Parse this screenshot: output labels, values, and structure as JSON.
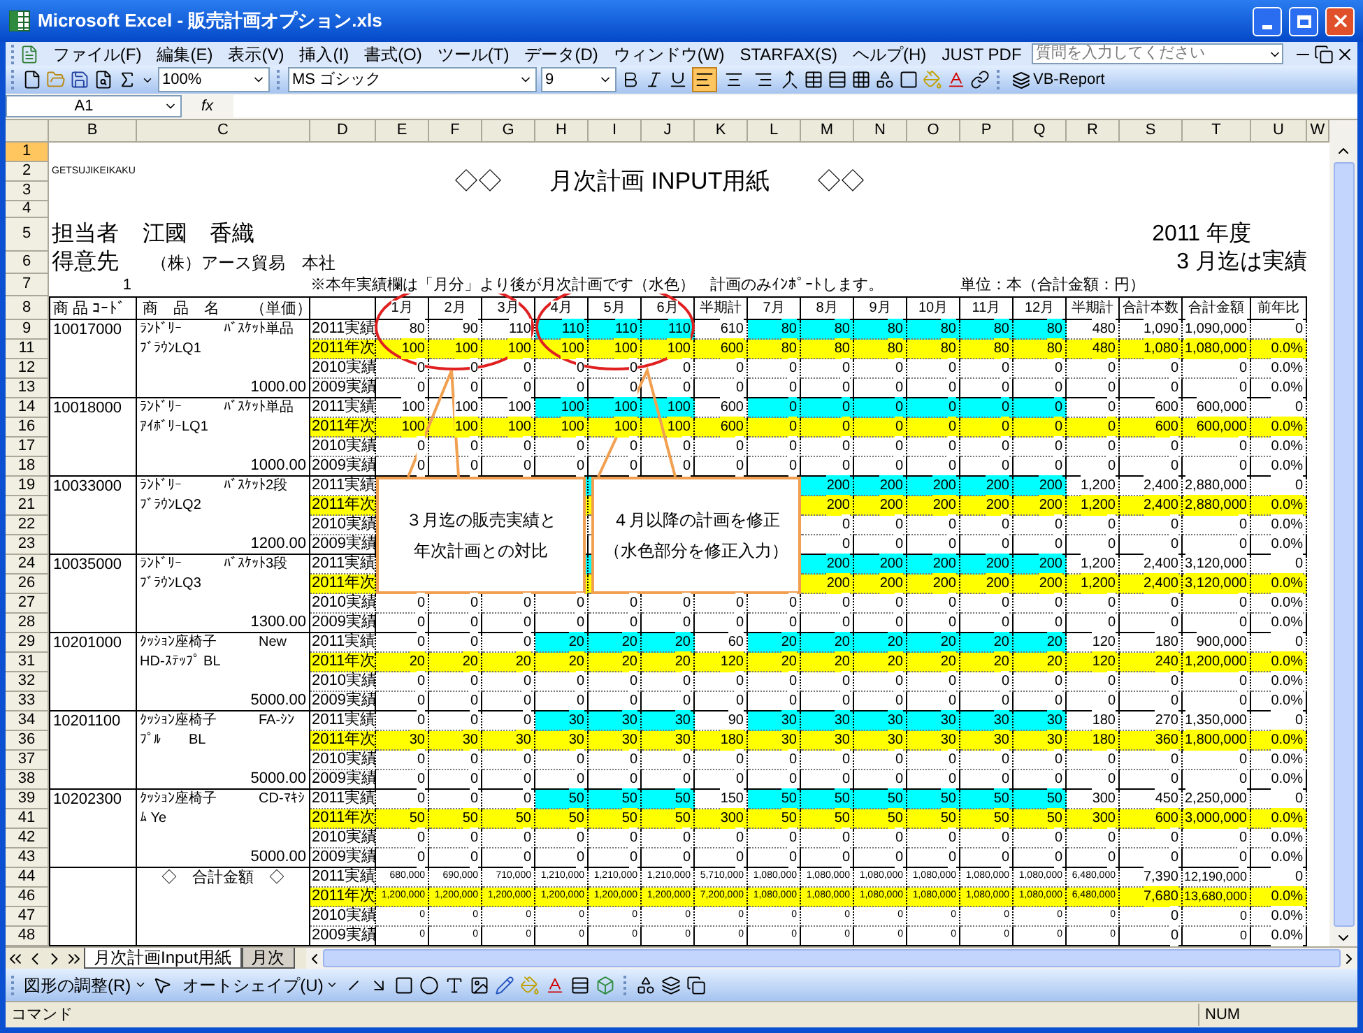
{
  "window": {
    "title": "Microsoft Excel - 販売計画オプション.xls"
  },
  "menu": [
    "ファイル(F)",
    "編集(E)",
    "表示(V)",
    "挿入(I)",
    "書式(O)",
    "ツール(T)",
    "データ(D)",
    "ウィンドウ(W)",
    "STARFAX(S)",
    "ヘルプ(H)",
    "JUST PDF"
  ],
  "help_search": {
    "placeholder": "質問を入力してください"
  },
  "toolbar": {
    "zoom": "100%",
    "font": "MS ゴシック",
    "size": "9",
    "addin": "VB-Report",
    "align_buttons": [
      {
        "selected": true
      },
      {
        "selected": false
      },
      {
        "selected": false
      }
    ]
  },
  "formula_bar": {
    "name_box": "A1",
    "function_label": "fx"
  },
  "columns": [
    "B",
    "C",
    "D",
    "E",
    "F",
    "G",
    "H",
    "I",
    "J",
    "K",
    "L",
    "M",
    "N",
    "O",
    "P",
    "Q",
    "R",
    "S",
    "T",
    "U",
    "W"
  ],
  "top_rows": [
    "1",
    "2",
    "3",
    "4",
    "5",
    "6",
    "7",
    "8"
  ],
  "sheet": {
    "code_label": "GETSUJIKEIKAKU",
    "title": "◇◇　　月次計画 INPUT用紙　　◇◇",
    "staff_label": "担当者",
    "staff_name": "江國　香織",
    "customer_label": "得意先",
    "customer_name": "（株）アース貿易　本社",
    "year": "2011 年度",
    "actual_until": "3 月迄は実績",
    "page_no": "1",
    "note": "※本年実績欄は「月分」より後が月次計画です（水色）　計画のみｲﾝﾎﾟｰﾄします。",
    "unit": "単位：本（合計金額：円）"
  },
  "table": {
    "code_header": "商 品 ｺｰﾄﾞ",
    "name_header": "商　品　名　　（単価）",
    "headers": [
      {
        "label": "1月",
        "editable": false
      },
      {
        "label": "2月",
        "editable": false
      },
      {
        "label": "3月",
        "editable": false
      },
      {
        "label": "4月",
        "editable": true
      },
      {
        "label": "5月",
        "editable": true
      },
      {
        "label": "6月",
        "editable": true
      },
      {
        "label": "半期計",
        "editable": false
      },
      {
        "label": "7月",
        "editable": true
      },
      {
        "label": "8月",
        "editable": true
      },
      {
        "label": "9月",
        "editable": true
      },
      {
        "label": "10月",
        "editable": true
      },
      {
        "label": "11月",
        "editable": true
      },
      {
        "label": "12月",
        "editable": true
      },
      {
        "label": "半期計",
        "editable": false
      },
      {
        "label": "合計本数",
        "editable": false
      },
      {
        "label": "合計金額",
        "editable": false
      },
      {
        "label": "前年比",
        "editable": false
      }
    ],
    "groups": [
      {
        "kind": "product",
        "code": "10017000",
        "name": [
          "ﾗﾝﾄﾞﾘｰ　　　ﾊﾞｽｹｯﾄ単品",
          "ﾌﾞﾗｳﾝLQ1"
        ],
        "price": "1000.00",
        "rows": [
          {
            "n": "9",
            "type": "2011実績",
            "kind": "actual",
            "cells": [
              "80",
              "90",
              "110",
              "110",
              "110",
              "110",
              "610",
              "80",
              "80",
              "80",
              "80",
              "80",
              "80",
              "480",
              "1,090",
              "1,090,000",
              "0"
            ]
          },
          {
            "n": "11",
            "type": "2011年次",
            "kind": "plan",
            "cells": [
              "100",
              "100",
              "100",
              "100",
              "100",
              "100",
              "600",
              "80",
              "80",
              "80",
              "80",
              "80",
              "80",
              "480",
              "1,080",
              "1,080,000",
              "0.0%"
            ]
          },
          {
            "n": "12",
            "type": "2010実績",
            "kind": "past",
            "cells": [
              "0",
              "0",
              "0",
              "0",
              "0",
              "0",
              "0",
              "0",
              "0",
              "0",
              "0",
              "0",
              "0",
              "0",
              "0",
              "0",
              "0.0%"
            ]
          },
          {
            "n": "13",
            "type": "2009実績",
            "kind": "past",
            "cells": [
              "0",
              "0",
              "0",
              "0",
              "0",
              "0",
              "0",
              "0",
              "0",
              "0",
              "0",
              "0",
              "0",
              "0",
              "0",
              "0",
              "0.0%"
            ]
          }
        ]
      },
      {
        "kind": "product",
        "code": "10018000",
        "name": [
          "ﾗﾝﾄﾞﾘｰ　　　ﾊﾞｽｹｯﾄ単品",
          "ｱｲﾎﾞﾘｰLQ1"
        ],
        "price": "1000.00",
        "rows": [
          {
            "n": "14",
            "type": "2011実績",
            "kind": "actual",
            "cells": [
              "100",
              "100",
              "100",
              "100",
              "100",
              "100",
              "600",
              "0",
              "0",
              "0",
              "0",
              "0",
              "0",
              "0",
              "600",
              "600,000",
              "0"
            ]
          },
          {
            "n": "16",
            "type": "2011年次",
            "kind": "plan",
            "cells": [
              "100",
              "100",
              "100",
              "100",
              "100",
              "100",
              "600",
              "0",
              "0",
              "0",
              "0",
              "0",
              "0",
              "0",
              "600",
              "600,000",
              "0.0%"
            ]
          },
          {
            "n": "17",
            "type": "2010実績",
            "kind": "past",
            "cells": [
              "0",
              "0",
              "0",
              "0",
              "0",
              "0",
              "0",
              "0",
              "0",
              "0",
              "0",
              "0",
              "0",
              "0",
              "0",
              "0",
              "0.0%"
            ]
          },
          {
            "n": "18",
            "type": "2009実績",
            "kind": "past",
            "cells": [
              "0",
              "0",
              "0",
              "0",
              "0",
              "0",
              "0",
              "0",
              "0",
              "0",
              "0",
              "0",
              "0",
              "0",
              "0",
              "0",
              "0.0%"
            ]
          }
        ]
      },
      {
        "kind": "product",
        "code": "10033000",
        "name": [
          "ﾗﾝﾄﾞﾘｰ　　　ﾊﾞｽｹｯﾄ2段",
          "ﾌﾞﾗｳﾝLQ2"
        ],
        "price": "1200.00",
        "rows": [
          {
            "n": "19",
            "type": "2011実績",
            "kind": "actual",
            "cells": [
              null,
              null,
              null,
              null,
              null,
              null,
              null,
              null,
              "200",
              "200",
              "200",
              "200",
              "200",
              "1,200",
              "2,400",
              "2,880,000",
              "0"
            ]
          },
          {
            "n": "21",
            "type": "2011年次",
            "kind": "plan",
            "cells": [
              null,
              null,
              null,
              null,
              null,
              null,
              null,
              null,
              "200",
              "200",
              "200",
              "200",
              "200",
              "1,200",
              "2,400",
              "2,880,000",
              "0.0%"
            ]
          },
          {
            "n": "22",
            "type": "2010実績",
            "kind": "past",
            "cells": [
              null,
              null,
              null,
              null,
              null,
              null,
              null,
              null,
              "0",
              "0",
              "0",
              "0",
              "0",
              "0",
              "0",
              "0",
              "0.0%"
            ]
          },
          {
            "n": "23",
            "type": "2009実績",
            "kind": "past",
            "cells": [
              null,
              null,
              null,
              null,
              null,
              null,
              null,
              null,
              "0",
              "0",
              "0",
              "0",
              "0",
              "0",
              "0",
              "0",
              "0.0%"
            ]
          }
        ]
      },
      {
        "kind": "product",
        "code": "10035000",
        "name": [
          "ﾗﾝﾄﾞﾘｰ　　　ﾊﾞｽｹｯﾄ3段",
          "ﾌﾞﾗｳﾝLQ3"
        ],
        "price": "1300.00",
        "rows": [
          {
            "n": "24",
            "type": "2011実績",
            "kind": "actual",
            "cells": [
              null,
              null,
              null,
              null,
              null,
              null,
              null,
              null,
              "200",
              "200",
              "200",
              "200",
              "200",
              "1,200",
              "2,400",
              "3,120,000",
              "0"
            ]
          },
          {
            "n": "26",
            "type": "2011年次",
            "kind": "plan",
            "cells": [
              null,
              null,
              null,
              null,
              null,
              null,
              null,
              null,
              "200",
              "200",
              "200",
              "200",
              "200",
              "1,200",
              "2,400",
              "3,120,000",
              "0.0%"
            ]
          },
          {
            "n": "27",
            "type": "2010実績",
            "kind": "past",
            "cells": [
              "0",
              "0",
              "0",
              "0",
              "0",
              "0",
              "0",
              "0",
              "0",
              "0",
              "0",
              "0",
              "0",
              "0",
              "0",
              "0",
              "0.0%"
            ]
          },
          {
            "n": "28",
            "type": "2009実績",
            "kind": "past",
            "cells": [
              "0",
              "0",
              "0",
              "0",
              "0",
              "0",
              "0",
              "0",
              "0",
              "0",
              "0",
              "0",
              "0",
              "0",
              "0",
              "0",
              "0.0%"
            ]
          }
        ]
      },
      {
        "kind": "product",
        "code": "10201000",
        "name": [
          "ｸｯｼｮﾝ座椅子　　　New",
          "HD-ｽﾃｯﾌﾟ BL"
        ],
        "price": "5000.00",
        "rows": [
          {
            "n": "29",
            "type": "2011実績",
            "kind": "actual",
            "cells": [
              "0",
              "0",
              "0",
              "20",
              "20",
              "20",
              "60",
              "20",
              "20",
              "20",
              "20",
              "20",
              "20",
              "120",
              "180",
              "900,000",
              "0"
            ]
          },
          {
            "n": "31",
            "type": "2011年次",
            "kind": "plan",
            "cells": [
              "20",
              "20",
              "20",
              "20",
              "20",
              "20",
              "120",
              "20",
              "20",
              "20",
              "20",
              "20",
              "20",
              "120",
              "240",
              "1,200,000",
              "0.0%"
            ]
          },
          {
            "n": "32",
            "type": "2010実績",
            "kind": "past",
            "cells": [
              "0",
              "0",
              "0",
              "0",
              "0",
              "0",
              "0",
              "0",
              "0",
              "0",
              "0",
              "0",
              "0",
              "0",
              "0",
              "0",
              "0.0%"
            ]
          },
          {
            "n": "33",
            "type": "2009実績",
            "kind": "past",
            "cells": [
              "0",
              "0",
              "0",
              "0",
              "0",
              "0",
              "0",
              "0",
              "0",
              "0",
              "0",
              "0",
              "0",
              "0",
              "0",
              "0",
              "0.0%"
            ]
          }
        ]
      },
      {
        "kind": "product",
        "code": "10201100",
        "name": [
          "ｸｯｼｮﾝ座椅子　　　FA-ｼﾝ",
          "ﾌﾟﾙ　　BL"
        ],
        "price": "5000.00",
        "rows": [
          {
            "n": "34",
            "type": "2011実績",
            "kind": "actual",
            "cells": [
              "0",
              "0",
              "0",
              "30",
              "30",
              "30",
              "90",
              "30",
              "30",
              "30",
              "30",
              "30",
              "30",
              "180",
              "270",
              "1,350,000",
              "0"
            ]
          },
          {
            "n": "36",
            "type": "2011年次",
            "kind": "plan",
            "cells": [
              "30",
              "30",
              "30",
              "30",
              "30",
              "30",
              "180",
              "30",
              "30",
              "30",
              "30",
              "30",
              "30",
              "180",
              "360",
              "1,800,000",
              "0.0%"
            ]
          },
          {
            "n": "37",
            "type": "2010実績",
            "kind": "past",
            "cells": [
              "0",
              "0",
              "0",
              "0",
              "0",
              "0",
              "0",
              "0",
              "0",
              "0",
              "0",
              "0",
              "0",
              "0",
              "0",
              "0",
              "0.0%"
            ]
          },
          {
            "n": "38",
            "type": "2009実績",
            "kind": "past",
            "cells": [
              "0",
              "0",
              "0",
              "0",
              "0",
              "0",
              "0",
              "0",
              "0",
              "0",
              "0",
              "0",
              "0",
              "0",
              "0",
              "0",
              "0.0%"
            ]
          }
        ]
      },
      {
        "kind": "product",
        "code": "10202300",
        "name": [
          "ｸｯｼｮﾝ座椅子　　　CD-ﾏｷｼ",
          "ﾑ Ye"
        ],
        "price": "5000.00",
        "rows": [
          {
            "n": "39",
            "type": "2011実績",
            "kind": "actual",
            "cells": [
              "0",
              "0",
              "0",
              "50",
              "50",
              "50",
              "150",
              "50",
              "50",
              "50",
              "50",
              "50",
              "50",
              "300",
              "450",
              "2,250,000",
              "0"
            ]
          },
          {
            "n": "41",
            "type": "2011年次",
            "kind": "plan",
            "cells": [
              "50",
              "50",
              "50",
              "50",
              "50",
              "50",
              "300",
              "50",
              "50",
              "50",
              "50",
              "50",
              "50",
              "300",
              "600",
              "3,000,000",
              "0.0%"
            ]
          },
          {
            "n": "42",
            "type": "2010実績",
            "kind": "past",
            "cells": [
              "0",
              "0",
              "0",
              "0",
              "0",
              "0",
              "0",
              "0",
              "0",
              "0",
              "0",
              "0",
              "0",
              "0",
              "0",
              "0",
              "0.0%"
            ]
          },
          {
            "n": "43",
            "type": "2009実績",
            "kind": "past",
            "cells": [
              "0",
              "0",
              "0",
              "0",
              "0",
              "0",
              "0",
              "0",
              "0",
              "0",
              "0",
              "0",
              "0",
              "0",
              "0",
              "0",
              "0.0%"
            ]
          }
        ]
      },
      {
        "kind": "total",
        "name": [
          "◇　合計金額　◇"
        ],
        "rows": [
          {
            "n": "44",
            "type": "2011実績",
            "kind": "sum",
            "cells": [
              "680,000",
              "690,000",
              "710,000",
              "1,210,000",
              "1,210,000",
              "1,210,000",
              "5,710,000",
              "1,080,000",
              "1,080,000",
              "1,080,000",
              "1,080,000",
              "1,080,000",
              "1,080,000",
              "6,480,000",
              "7,390",
              "12,190,000",
              "0"
            ]
          },
          {
            "n": "46",
            "type": "2011年次",
            "kind": "plan",
            "cells": [
              "1,200,000",
              "1,200,000",
              "1,200,000",
              "1,200,000",
              "1,200,000",
              "1,200,000",
              "7,200,000",
              "1,080,000",
              "1,080,000",
              "1,080,000",
              "1,080,000",
              "1,080,000",
              "1,080,000",
              "6,480,000",
              "7,680",
              "13,680,000",
              "0.0%"
            ]
          },
          {
            "n": "47",
            "type": "2010実績",
            "kind": "past",
            "cells": [
              "0",
              "0",
              "0",
              "0",
              "0",
              "0",
              "0",
              "0",
              "0",
              "0",
              "0",
              "0",
              "0",
              "0",
              "0",
              "0",
              "0.0%"
            ]
          },
          {
            "n": "48",
            "type": "2009実績",
            "kind": "past",
            "cells": [
              "0",
              "0",
              "0",
              "0",
              "0",
              "0",
              "0",
              "0",
              "0",
              "0",
              "0",
              "0",
              "0",
              "0",
              "0",
              "0",
              "0.0%"
            ]
          }
        ]
      }
    ]
  },
  "callouts": [
    {
      "lines": [
        "３月迄の販売実績と",
        "年次計画との対比"
      ]
    },
    {
      "lines": [
        "４月以降の計画を修正",
        "（水色部分を修正入力）"
      ]
    }
  ],
  "sheet_tabs": [
    {
      "label": "月次計画Input用紙",
      "selected": true
    },
    {
      "label": "月次",
      "selected": false
    }
  ],
  "drawing_toolbar": {
    "draw": "図形の調整(R)",
    "autoshape": "オートシェイプ(U)"
  },
  "status_bar": {
    "mode": "コマンド",
    "num": "NUM"
  }
}
